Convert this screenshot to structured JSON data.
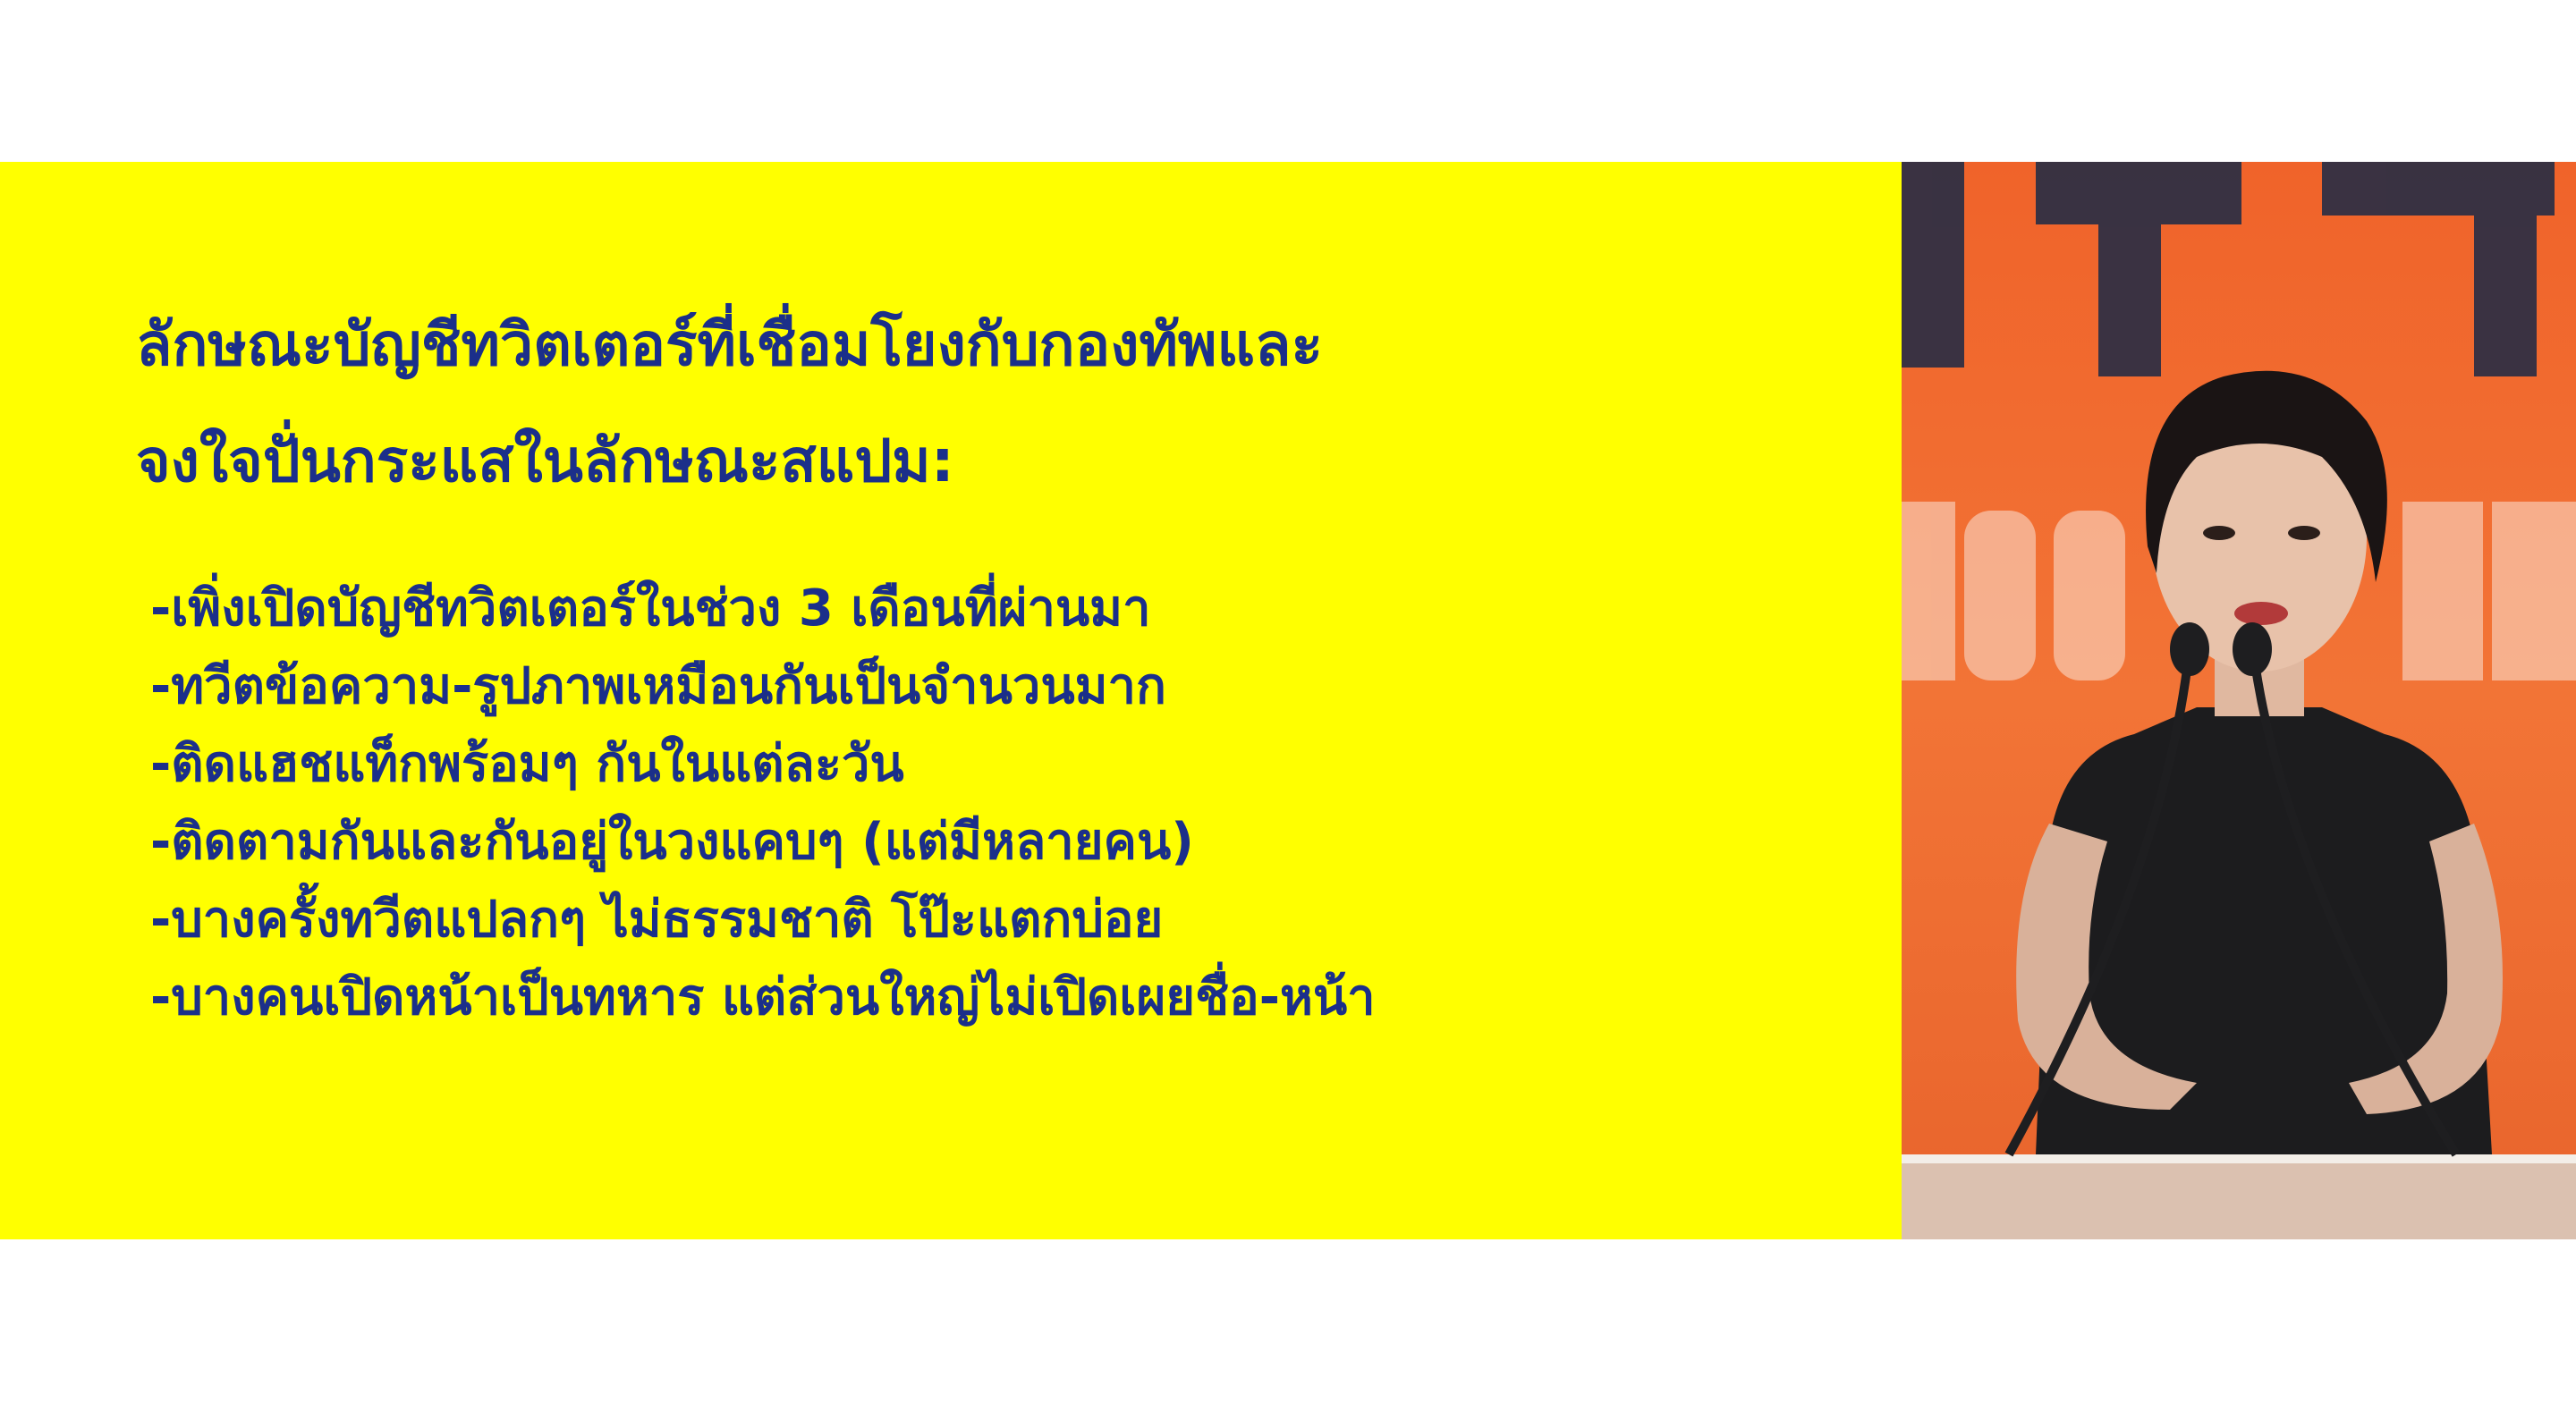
{
  "slide": {
    "title_lines": [
      "ลักษณะบัญชีทวิตเตอร์ที่เชื่อมโยงกับกองทัพและ",
      "จงใจปั่นกระแสในลักษณะสแปม:"
    ],
    "bullets": [
      "-เพิ่งเปิดบัญชีทวิตเตอร์ในช่วง 3 เดือนที่ผ่านมา",
      "-ทวีตข้อความ-รูปภาพเหมือนกันเป็นจำนวนมาก",
      "-ติดแฮชแท็กพร้อมๆ กันในแต่ละวัน",
      "-ติดตามกันและกันอยู่ในวงแคบๆ (แต่มีหลายคน)",
      "-บางครั้งทวีตแปลกๆ ไม่ธรรมชาติ โป๊ะแตกบ่อย",
      "-บางคนเปิดหน้าเป็นทหาร แต่ส่วนใหญ่ไม่เปิดเผยชื่อ-หน้า"
    ]
  },
  "colors": {
    "slide_background": "#ffff00",
    "slide_text": "#1b2f8a",
    "stage_background": "#f0632a",
    "page_background": "#ffffff"
  }
}
